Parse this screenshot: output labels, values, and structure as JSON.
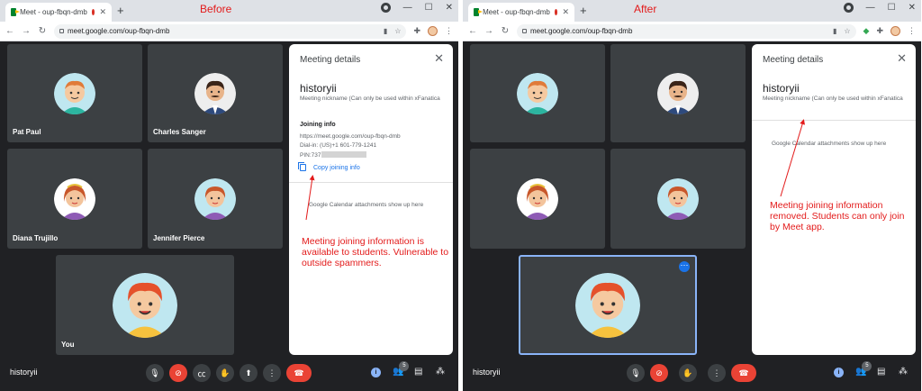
{
  "before": {
    "annotation_title": "Before",
    "tab_title": "Meet - oup-fbqn-dmb",
    "url": "meet.google.com/oup-fbqn-dmb",
    "participants": [
      "Pat Paul",
      "Charles Sanger",
      "Diana Trujillo",
      "Jennifer Pierce",
      "You"
    ],
    "details": {
      "title": "Meeting details",
      "nickname": "historyii",
      "nickname_sub": "Meeting nickname (Can only be used within xFanatica",
      "joining_header": "Joining info",
      "link": "https://meet.google.com/oup-fbqn-dmb",
      "dial_in": "Dial-in: (US)+1 601-779-1241",
      "pin": "PIN:737",
      "copy_label": "Copy joining info",
      "calendar_note": "Google Calendar attachments show up here"
    },
    "annotation": "Meeting joining information is available to students. Vulnerable to outside spammers.",
    "meeting_name": "historyii",
    "people_count": "5"
  },
  "after": {
    "annotation_title": "After",
    "tab_title": "Meet - oup-fbqn-dmb",
    "url": "meet.google.com/oup-fbqn-dmb",
    "details": {
      "title": "Meeting details",
      "nickname": "historyii",
      "nickname_sub": "Meeting nickname (Can only be used within xFanatica",
      "calendar_note": "Google Calendar attachments show up here"
    },
    "annotation": "Meeting joining information removed. Students can only join by Meet app.",
    "meeting_name": "historyii",
    "people_count": "5"
  },
  "colors": {
    "meet_bg": "#202124",
    "tile_bg": "#3c4043",
    "end_call": "#ea4335",
    "link_blue": "#1a73e8",
    "annotation_red": "#e31b1b"
  },
  "icons": [
    "meet-logo-icon",
    "record-dot-icon",
    "mic-icon",
    "camera-off-icon",
    "captions-icon",
    "raise-hand-icon",
    "present-icon",
    "more-options-icon",
    "end-call-icon",
    "info-icon",
    "people-icon",
    "chat-icon",
    "activities-icon",
    "copy-icon",
    "close-icon"
  ]
}
